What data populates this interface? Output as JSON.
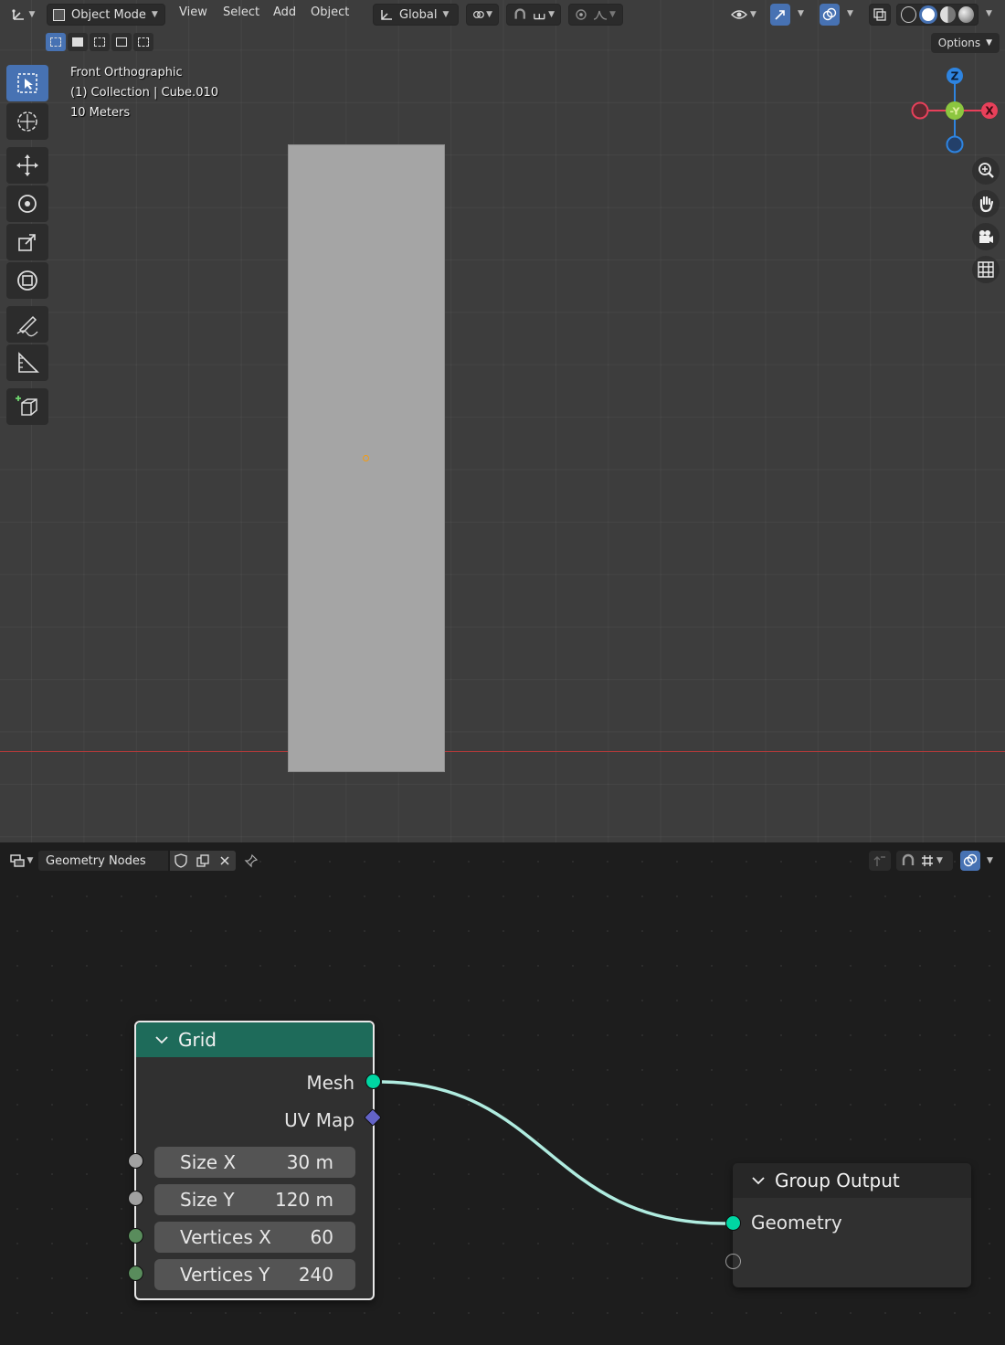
{
  "colors": {
    "accent": "#4772b3",
    "grid_node_header": "#1e6b5a",
    "geometry_socket": "#00d6a3",
    "vector_socket": "#6363c7",
    "float_socket": "#a1a1a1",
    "int_socket": "#598c5c",
    "link": "#b0ece0",
    "axis_x": "#e8405a",
    "axis_y": "#8cc63f",
    "axis_z": "#2e84e0",
    "origin": "#f39c12"
  },
  "viewport": {
    "header": {
      "mode": "Object Mode",
      "menus": [
        "View",
        "Select",
        "Add",
        "Object"
      ],
      "transform_orientation": "Global",
      "options": "Options"
    },
    "overlay": {
      "view_name": "Front Orthographic",
      "collection_object": "(1) Collection | Cube.010",
      "scale": "10 Meters"
    },
    "gizmo": {
      "z": "Z",
      "neg_y": "-Y",
      "x": "X"
    },
    "tools": [
      "select-box",
      "cursor",
      "move",
      "rotate",
      "scale",
      "transform",
      "annotate",
      "measure",
      "add-cube"
    ]
  },
  "node_editor": {
    "header": {
      "tree_name": "Geometry Nodes"
    },
    "grid_node": {
      "title": "Grid",
      "outputs": [
        "Mesh",
        "UV Map"
      ],
      "inputs": [
        {
          "label": "Size X",
          "value": "30 m"
        },
        {
          "label": "Size Y",
          "value": "120 m"
        },
        {
          "label": "Vertices X",
          "value": "60"
        },
        {
          "label": "Vertices Y",
          "value": "240"
        }
      ]
    },
    "output_node": {
      "title": "Group Output",
      "inputs": [
        "Geometry"
      ]
    }
  }
}
